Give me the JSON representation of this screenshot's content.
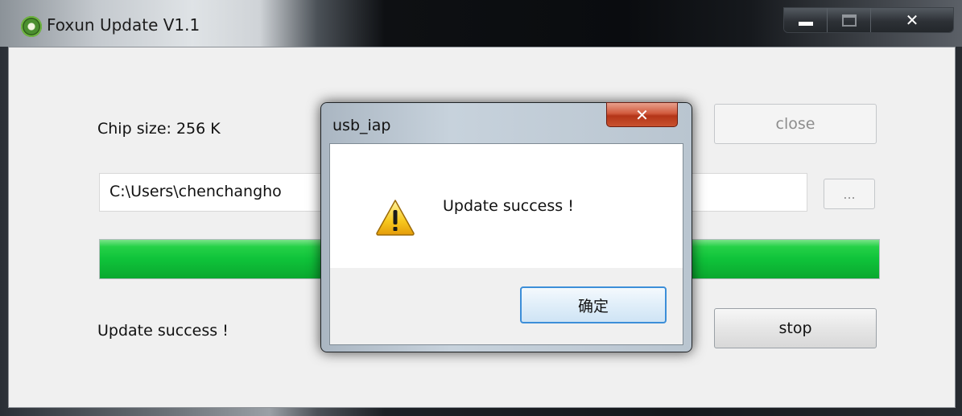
{
  "window": {
    "title": "Foxun Update V1.1",
    "minimize_glyph": "",
    "close_glyph": "✕"
  },
  "main": {
    "chip_size_label": "Chip size: 256 K",
    "close_button": "close",
    "file_path": "C:\\Users\\chenchangho",
    "browse_button": "...",
    "progress_percent": 100,
    "status_text": "Update success !",
    "stop_button": "stop"
  },
  "dialog": {
    "title": "usb_iap",
    "close_glyph": "✕",
    "icon": "warning-icon",
    "message": "Update success !",
    "ok_button": "确定"
  },
  "colors": {
    "progress_green": "#0fc33a",
    "dialog_close_red": "#c8522e",
    "focus_blue": "#3c8ed8"
  }
}
